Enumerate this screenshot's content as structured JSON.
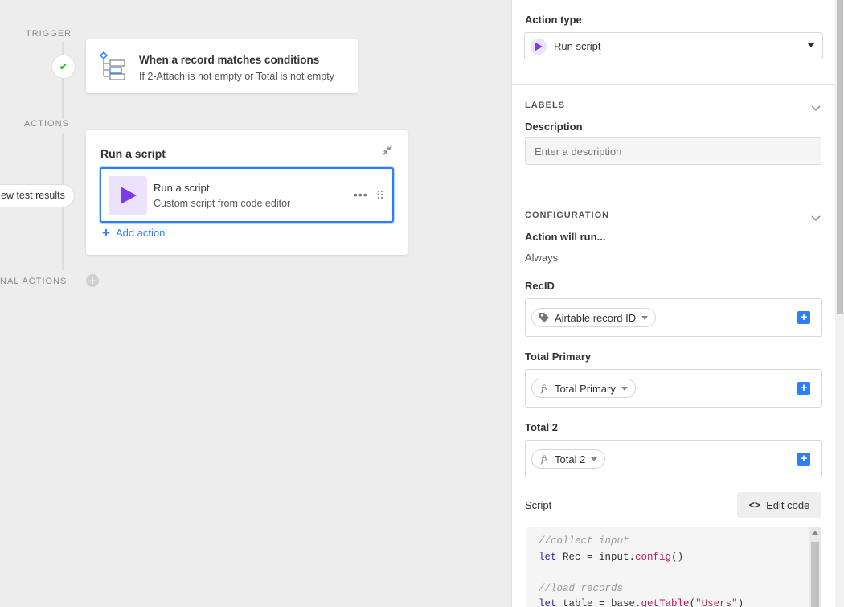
{
  "canvas": {
    "trigger_label": "TRIGGER",
    "actions_label": "ACTIONS",
    "conditional_label": "NAL ACTIONS",
    "view_results_label": "ew test results",
    "trigger": {
      "title": "When a record matches conditions",
      "subtitle": "If 2-Attach is not empty or Total is not empty"
    },
    "action_card": {
      "title": "Run a script",
      "item_name": "Run a script",
      "item_desc": "Custom script from code editor",
      "more_label": "•••",
      "add_action_label": "Add action"
    }
  },
  "panel": {
    "action_type_label": "Action type",
    "action_type_value": "Run script",
    "labels_section": "LABELS",
    "description_label": "Description",
    "description_placeholder": "Enter a description",
    "configuration_section": "CONFIGURATION",
    "action_will_run_label": "Action will run...",
    "action_will_run_value": "Always",
    "inputs": [
      {
        "label": "RecID",
        "token": "Airtable record ID",
        "icon": "tag-icon"
      },
      {
        "label": "Total Primary",
        "token": "Total Primary",
        "icon": "formula-icon"
      },
      {
        "label": "Total 2",
        "token": "Total 2",
        "icon": "formula-icon"
      }
    ],
    "script_label": "Script",
    "edit_code_label": "Edit code",
    "code": {
      "line1": "//collect input",
      "line2_kw": "let",
      "line2_rest": " Rec = input.",
      "line2_fn": "config",
      "line2_end": "()",
      "line4": "//load records",
      "line5_kw": "let",
      "line5_rest": " table = base.",
      "line5_fn": "getTable",
      "line5_paren": "(",
      "line5_str": "\"Users\"",
      "line5_end": ")"
    }
  },
  "colors": {
    "accent_blue": "#2d7ff9",
    "script_purple": "#7c39ed",
    "script_purple_bg": "#ede2fe",
    "success_green": "#20c933"
  }
}
